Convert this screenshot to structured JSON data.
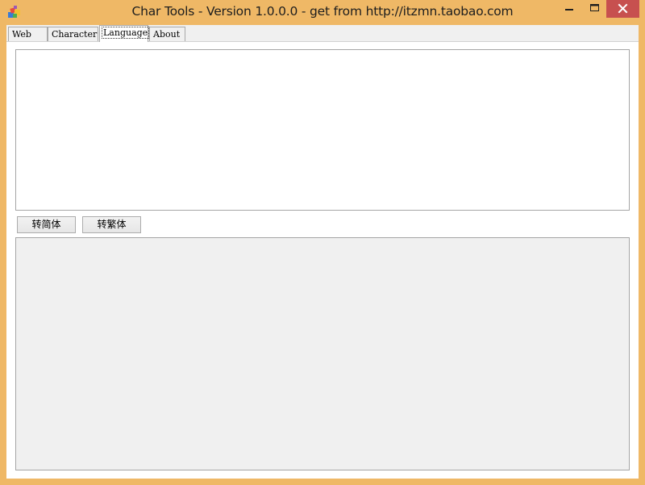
{
  "window": {
    "title": "Char Tools - Version 1.0.0.0 - get from http://itzmn.taobao.com",
    "app_icon": "app-icon",
    "controls": {
      "minimize_icon": "minimize-icon",
      "maximize_icon": "maximize-icon",
      "close_icon": "close-icon"
    },
    "frame_color": "#efb866",
    "close_color": "#c7504f"
  },
  "tabs": [
    {
      "label": "Web",
      "active": false
    },
    {
      "label": "Character",
      "active": false
    },
    {
      "label": "Language",
      "active": true
    },
    {
      "label": "About",
      "active": false
    }
  ],
  "language_panel": {
    "input_text": "",
    "output_text": "",
    "to_simplified_label": "转简体",
    "to_traditional_label": "转繁体"
  }
}
